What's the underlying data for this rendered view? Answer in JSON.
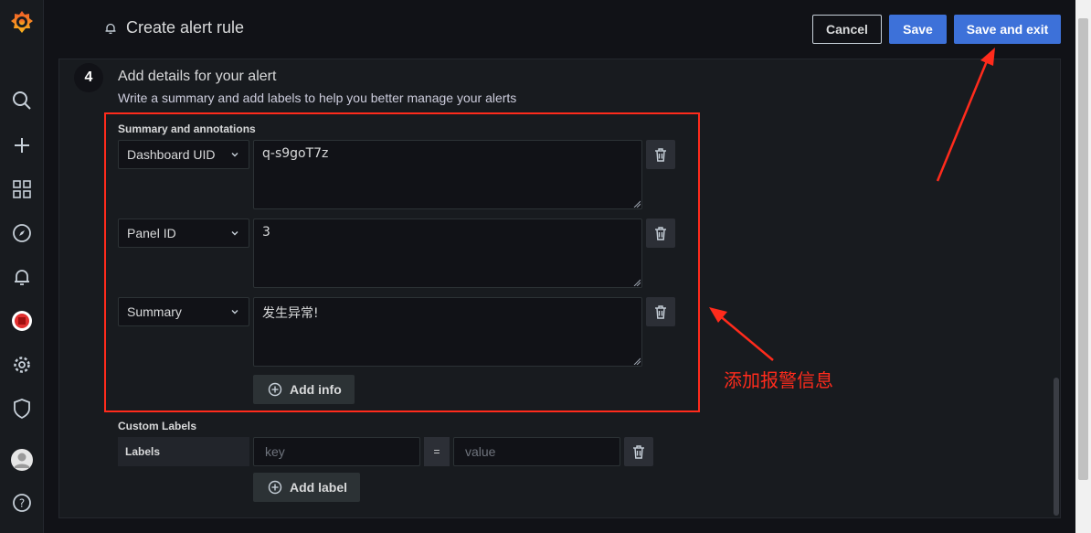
{
  "header": {
    "title": "Create alert rule",
    "cancel_label": "Cancel",
    "save_label": "Save",
    "save_exit_label": "Save and exit"
  },
  "step": {
    "number": "4",
    "title": "Add details for your alert",
    "description": "Write a summary and add labels to help you better manage your alerts"
  },
  "annotations": {
    "section_label": "Summary and annotations",
    "rows": [
      {
        "key": "Dashboard UID",
        "value": "q-s9goT7z"
      },
      {
        "key": "Panel ID",
        "value": "3"
      },
      {
        "key": "Summary",
        "value": "发生异常!"
      }
    ],
    "add_info_label": "Add info"
  },
  "custom_labels": {
    "section_label": "Custom Labels",
    "tag": "Labels",
    "key_placeholder": "key",
    "equals": "=",
    "value_placeholder": "value",
    "add_label_label": "Add label"
  },
  "overlay": {
    "note": "添加报警信息",
    "color": "#ff2b1c"
  },
  "sidebar": {
    "icons": [
      "grafana-logo-icon",
      "search-icon",
      "plus-icon",
      "dashboards-icon",
      "explore-compass-icon",
      "alert-bell-icon",
      "plugin-badge-icon",
      "gear-icon",
      "shield-icon",
      "user-avatar-icon",
      "help-icon"
    ]
  },
  "colors": {
    "primary": "#3d71d9",
    "background": "#111217",
    "panel": "#181b1f"
  }
}
